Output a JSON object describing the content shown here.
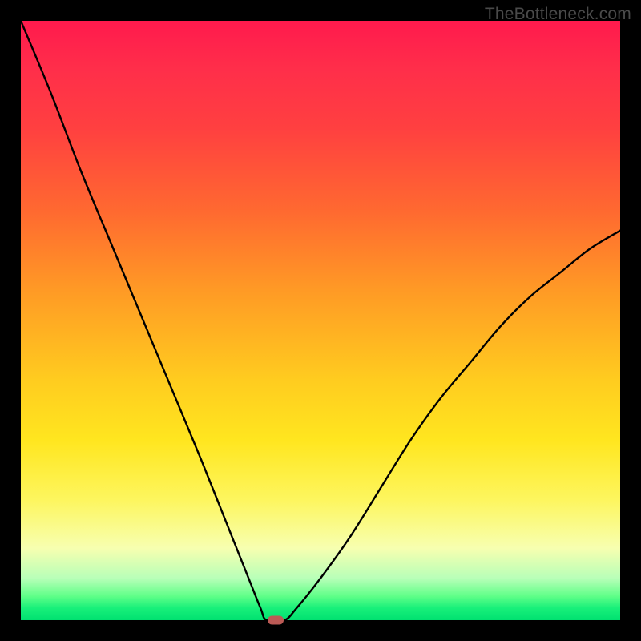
{
  "watermark": "TheBottleneck.com",
  "chart_data": {
    "type": "line",
    "title": "",
    "xlabel": "",
    "ylabel": "",
    "xlim": [
      0,
      100
    ],
    "ylim": [
      0,
      100
    ],
    "grid": false,
    "legend": false,
    "series": [
      {
        "name": "bottleneck-curve",
        "x": [
          0,
          5,
          10,
          15,
          20,
          25,
          30,
          34,
          38,
          40,
          41,
          44,
          46,
          50,
          55,
          60,
          65,
          70,
          75,
          80,
          85,
          90,
          95,
          100
        ],
        "y": [
          100,
          88,
          75,
          63,
          51,
          39,
          27,
          17,
          7,
          2,
          0,
          0,
          2,
          7,
          14,
          22,
          30,
          37,
          43,
          49,
          54,
          58,
          62,
          65
        ]
      }
    ],
    "annotations": [
      {
        "name": "optimal-marker",
        "x": 42.5,
        "y": 0.0
      }
    ],
    "background_gradient": {
      "top": "#ff1a4d",
      "mid": "#ffe61f",
      "bottom": "#00e070"
    }
  }
}
